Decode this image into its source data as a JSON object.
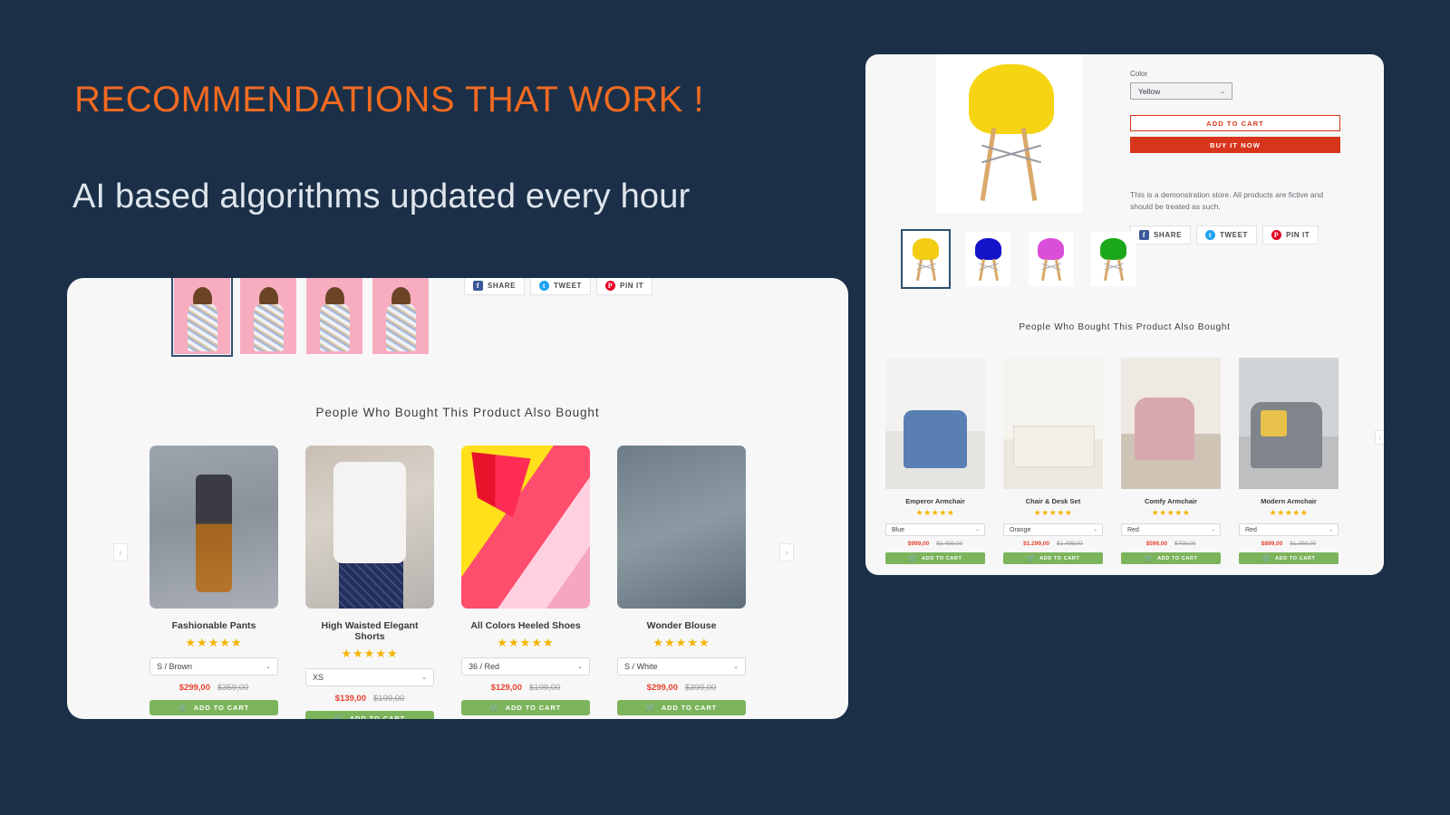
{
  "hero": {
    "headline": "RECOMMENDATIONS THAT WORK !",
    "subheadline": "AI based algorithms updated every hour",
    "accent_color": "#f26a21",
    "background_color": "#1b3048",
    "subheadline_color": "#dfe5ec"
  },
  "social": {
    "share_label": "SHARE",
    "tweet_label": "TWEET",
    "pin_label": "PIN IT",
    "facebook_glyph": "f",
    "twitter_glyph": "t",
    "pinterest_glyph": "P",
    "facebook_color": "#3b5998",
    "twitter_color": "#1da1f2",
    "pinterest_color": "#e60023"
  },
  "left_card": {
    "recommendation_title": "People Who Bought This Product Also Bought",
    "prev_arrow": "‹",
    "next_arrow": "›",
    "thumbnails": [
      {
        "name": "dress-thumb-1",
        "selected": true
      },
      {
        "name": "dress-thumb-2",
        "selected": false
      },
      {
        "name": "dress-thumb-3",
        "selected": false
      },
      {
        "name": "dress-thumb-4",
        "selected": false
      }
    ],
    "products": [
      {
        "name": "Fashionable Pants",
        "stars": "★★★★★",
        "variant": "S / Brown",
        "price_new": "$299,00",
        "price_old": "$359,00",
        "add_to_cart": "ADD TO CART",
        "photo_class": "ph-pants"
      },
      {
        "name": "High Waisted Elegant Shorts",
        "stars": "★★★★★",
        "variant": "XS",
        "price_new": "$139,00",
        "price_old": "$199,00",
        "add_to_cart": "ADD TO CART",
        "photo_class": "ph-shorts"
      },
      {
        "name": "All Colors Heeled Shoes",
        "stars": "★★★★★",
        "variant": "36 / Red",
        "price_new": "$129,00",
        "price_old": "$199,00",
        "add_to_cart": "ADD TO CART",
        "photo_class": "ph-shoes"
      },
      {
        "name": "Wonder Blouse",
        "stars": "★★★★★",
        "variant": "S / White",
        "price_new": "$299,00",
        "price_old": "$399,00",
        "add_to_cart": "ADD TO CART",
        "photo_class": "ph-blouse"
      }
    ]
  },
  "right_card": {
    "option_label": "Color",
    "option_value": "Yellow",
    "add_to_cart_label": "ADD TO CART",
    "buy_now_label": "BUY IT NOW",
    "demo_notice": "This is a demonstration store. All products are fictive and should be treated as such.",
    "recommendation_title": "People Who Bought This Product Also Bought",
    "prev_arrow": "‹",
    "next_arrow": "›",
    "thumbnails": [
      {
        "name": "chair-yellow",
        "color": "#f2cd13",
        "selected": true
      },
      {
        "name": "chair-blue",
        "color": "#1414c8",
        "selected": false
      },
      {
        "name": "chair-magenta",
        "color": "#d94fd9",
        "selected": false
      },
      {
        "name": "chair-green",
        "color": "#1aa81a",
        "selected": false
      }
    ],
    "products": [
      {
        "name": "Emperor Armchair",
        "stars": "★★★★★",
        "variant": "Blue",
        "price_new": "$999,00",
        "price_old": "$1.499,00",
        "add_to_cart": "ADD TO CART",
        "photo_class": "ph-blue-arm"
      },
      {
        "name": "Chair & Desk Set",
        "stars": "★★★★★",
        "variant": "Orange",
        "price_new": "$1.299,00",
        "price_old": "$1.499,00",
        "add_to_cart": "ADD TO CART",
        "photo_class": "ph-desk"
      },
      {
        "name": "Comfy Armchair",
        "stars": "★★★★★",
        "variant": "Red",
        "price_new": "$599,00",
        "price_old": "$799,00",
        "add_to_cart": "ADD TO CART",
        "photo_class": "ph-pink-arm"
      },
      {
        "name": "Modern Armchair",
        "stars": "★★★★★",
        "variant": "Red",
        "price_new": "$899,00",
        "price_old": "$1.299,00",
        "add_to_cart": "ADD TO CART",
        "photo_class": "ph-gray-arm"
      }
    ]
  },
  "icons": {
    "cart": "🛒",
    "chevron_down": "⌄"
  }
}
